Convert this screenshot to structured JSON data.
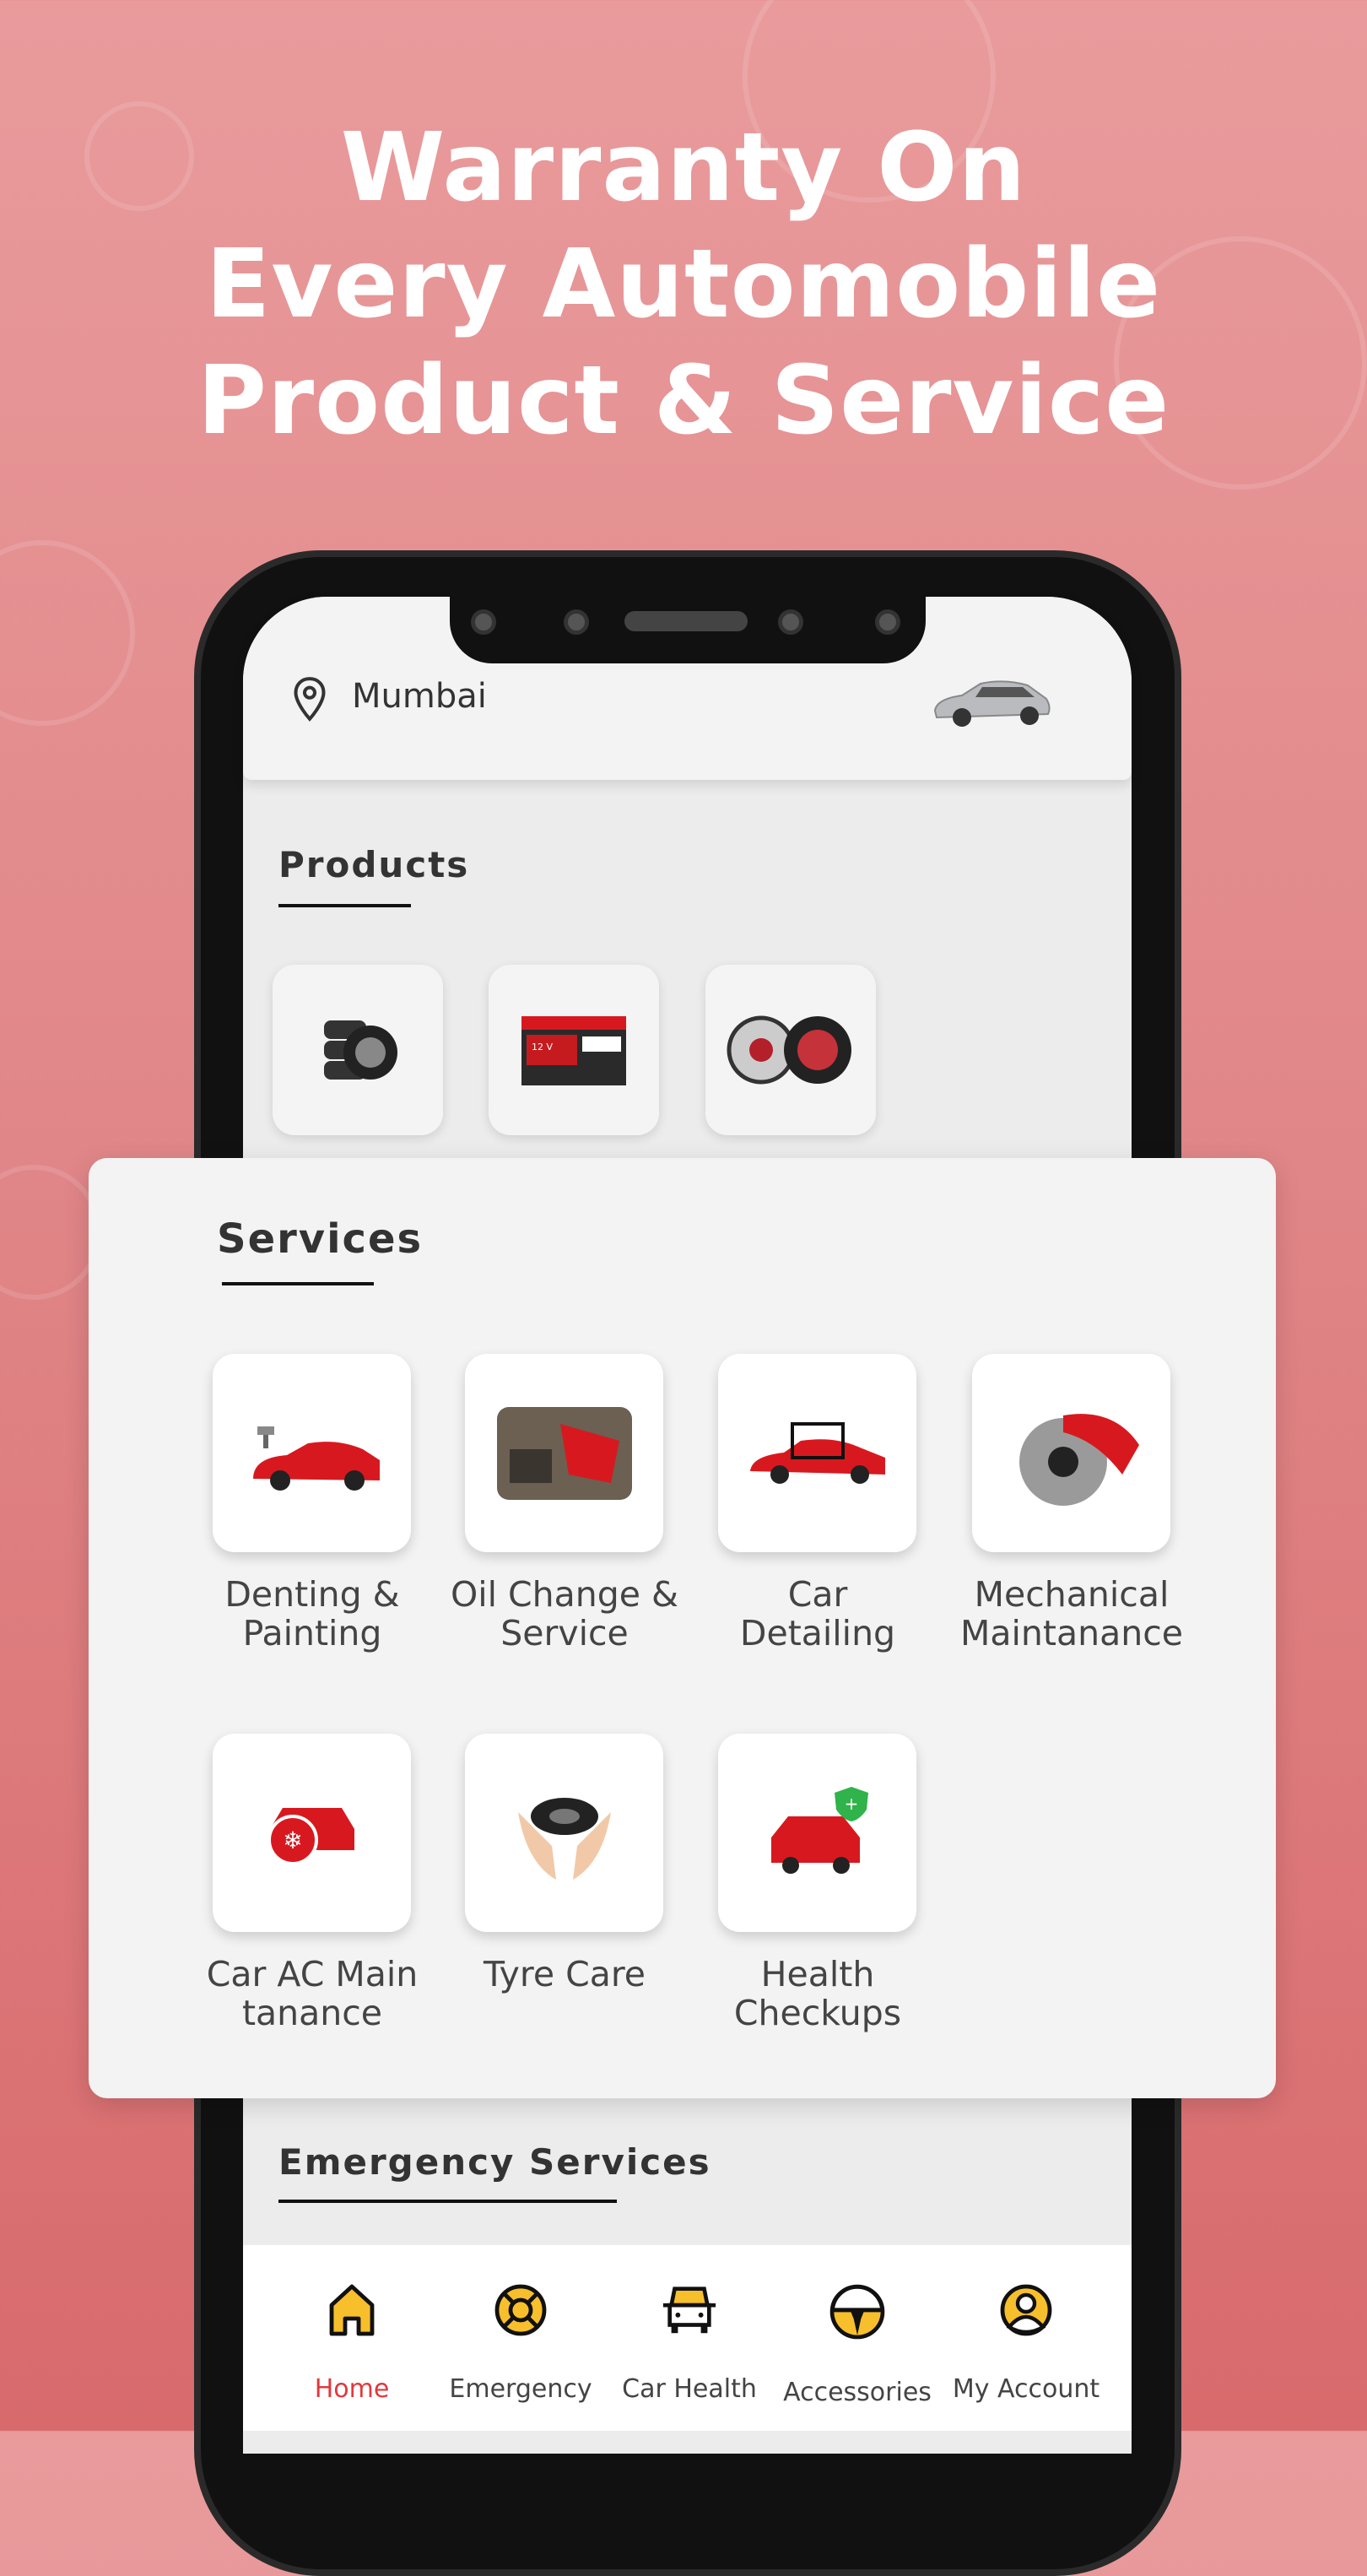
{
  "headline": [
    "Warranty On",
    "Every Automobile",
    "Product & Service"
  ],
  "header": {
    "location": "Mumbai",
    "location_icon": "map-pin-icon",
    "car_image": "silver-sports-car"
  },
  "products": {
    "title": "Products",
    "items": [
      {
        "icon": "tyres-image"
      },
      {
        "icon": "car-battery-image",
        "label_on_image": "12 V"
      },
      {
        "icon": "car-speakers-image"
      }
    ]
  },
  "services": {
    "title": "Services",
    "items": [
      {
        "label": "Denting & Painting",
        "icon": "car-spray-paint-image"
      },
      {
        "label": "Oil Change & Service",
        "icon": "engine-oil-image"
      },
      {
        "label": "Car Detailing",
        "icon": "car-detailing-image"
      },
      {
        "label": "Mechanical Maintanance",
        "icon": "brake-disc-image"
      },
      {
        "label": "Car AC Main tanance",
        "icon": "car-ac-image"
      },
      {
        "label": "Tyre Care",
        "icon": "tyre-in-hands-image"
      },
      {
        "label": "Health Checkups",
        "icon": "car-health-shield-image"
      }
    ]
  },
  "emergency": {
    "title": "Emergency Services"
  },
  "nav": {
    "items": [
      {
        "label": "Home",
        "icon": "home-icon",
        "active": true
      },
      {
        "label": "Emergency",
        "icon": "lifebuoy-icon"
      },
      {
        "label": "Car Health",
        "icon": "car-icon"
      },
      {
        "label": "Accessories",
        "icon": "steering-wheel-icon"
      },
      {
        "label": "My Account",
        "icon": "user-circle-icon"
      }
    ]
  },
  "colors": {
    "background": "#e08587",
    "active_nav": "#e0393e",
    "nav_icon_fill": "#f7bf2c",
    "accent_red": "#d7191f"
  }
}
